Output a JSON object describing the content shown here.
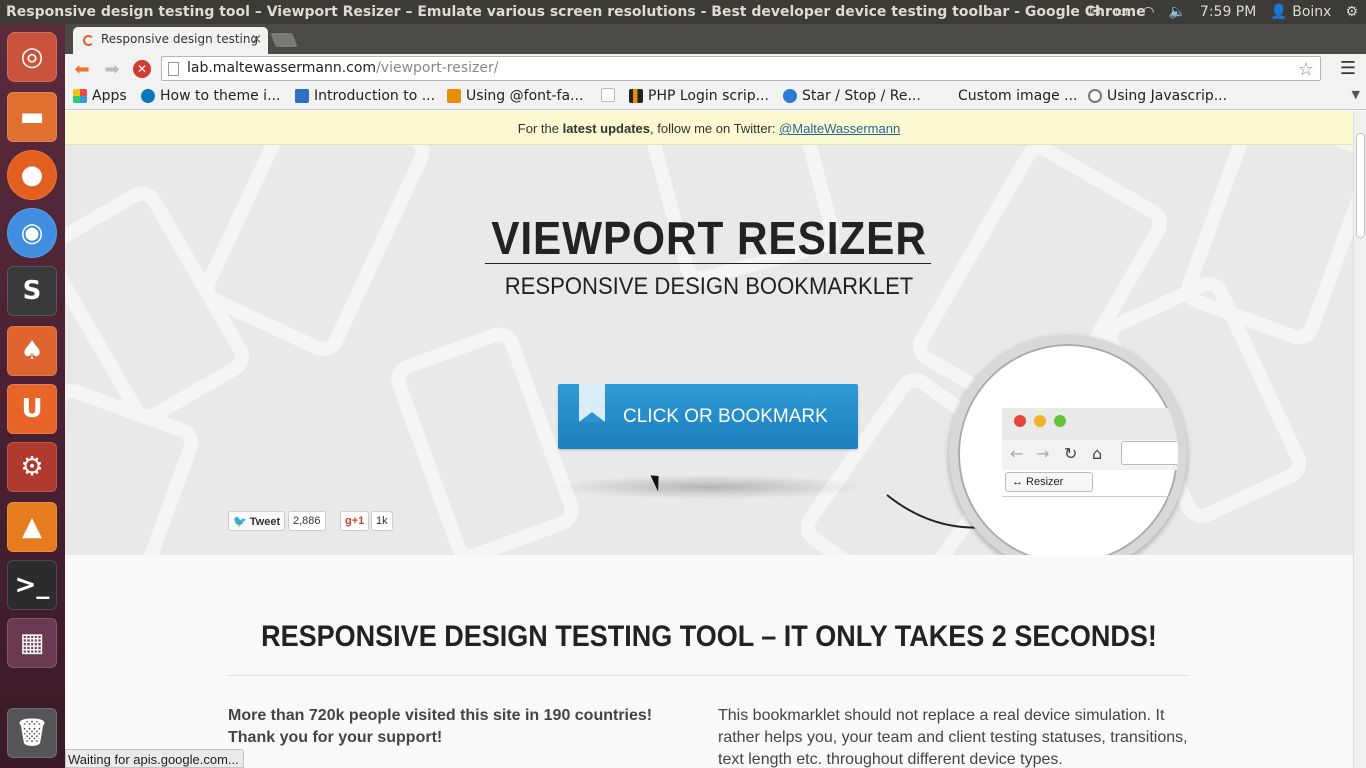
{
  "window": {
    "title": "Responsive design testing tool – Viewport Resizer – Emulate various screen resolutions - Best developer device testing toolbar - Google Chrome",
    "clock": "7:59 PM",
    "user": "Boinx"
  },
  "tab": {
    "label": "Responsive design testing",
    "close": "×"
  },
  "omnibox": {
    "host": "lab.maltewassermann.com",
    "path": "/viewport-resizer/"
  },
  "bookmarks": [
    {
      "label": "Apps",
      "icon": "apps-grid-icon",
      "color": "#e74c3c"
    },
    {
      "label": "How to theme i...",
      "icon": "drupal-icon",
      "color": "#0678be"
    },
    {
      "label": "Introduction to ...",
      "icon": "blue-square-icon",
      "color": "#2d6ec6"
    },
    {
      "label": "Using @font-fa...",
      "icon": "asterisk-icon",
      "color": "#e58e0b"
    },
    {
      "label": "",
      "icon": "page-icon",
      "color": "#cccccc"
    },
    {
      "label": "PHP Login scrip...",
      "icon": "chart-icon",
      "color": "#222222"
    },
    {
      "label": "Star / Stop / Re...",
      "icon": "globe-icon",
      "color": "#2d7bd6"
    },
    {
      "label": "Custom image ...",
      "icon": "",
      "color": ""
    },
    {
      "label": "Using Javascrip...",
      "icon": "wordpress-icon",
      "color": "#777777"
    }
  ],
  "notice": {
    "prefix": "For the ",
    "bold": "latest updates",
    "middle": ", follow me on Twitter: ",
    "link": "@MalteWassermann"
  },
  "hero": {
    "title": "VIEWPORT RESIZER",
    "subtitle": "RESPONSIVE DESIGN BOOKMARKLET",
    "cta": "CLICK OR BOOKMARK",
    "tweet_label": "Tweet",
    "tweet_count": "2,886",
    "gplus_label": "+1",
    "gplus_count": "1k",
    "resizer_label": "↔ Resizer"
  },
  "content": {
    "title": "RESPONSIVE DESIGN TESTING TOOL – IT ONLY TAKES 2 SECONDS!",
    "left_line1": "More than 720k people visited this site in 190 countries!",
    "left_line2": "Thank you for your support!",
    "right_text": "This bookmarklet should not replace a real device simulation. It rather helps you, your team and client testing statuses, transitions, text length etc. throughout different device types."
  },
  "status": "Waiting for apis.google.com...",
  "colors": {
    "cta": "#2a8fcf",
    "notice_bg": "#fbf9cf",
    "launcher": "#4a2233"
  }
}
